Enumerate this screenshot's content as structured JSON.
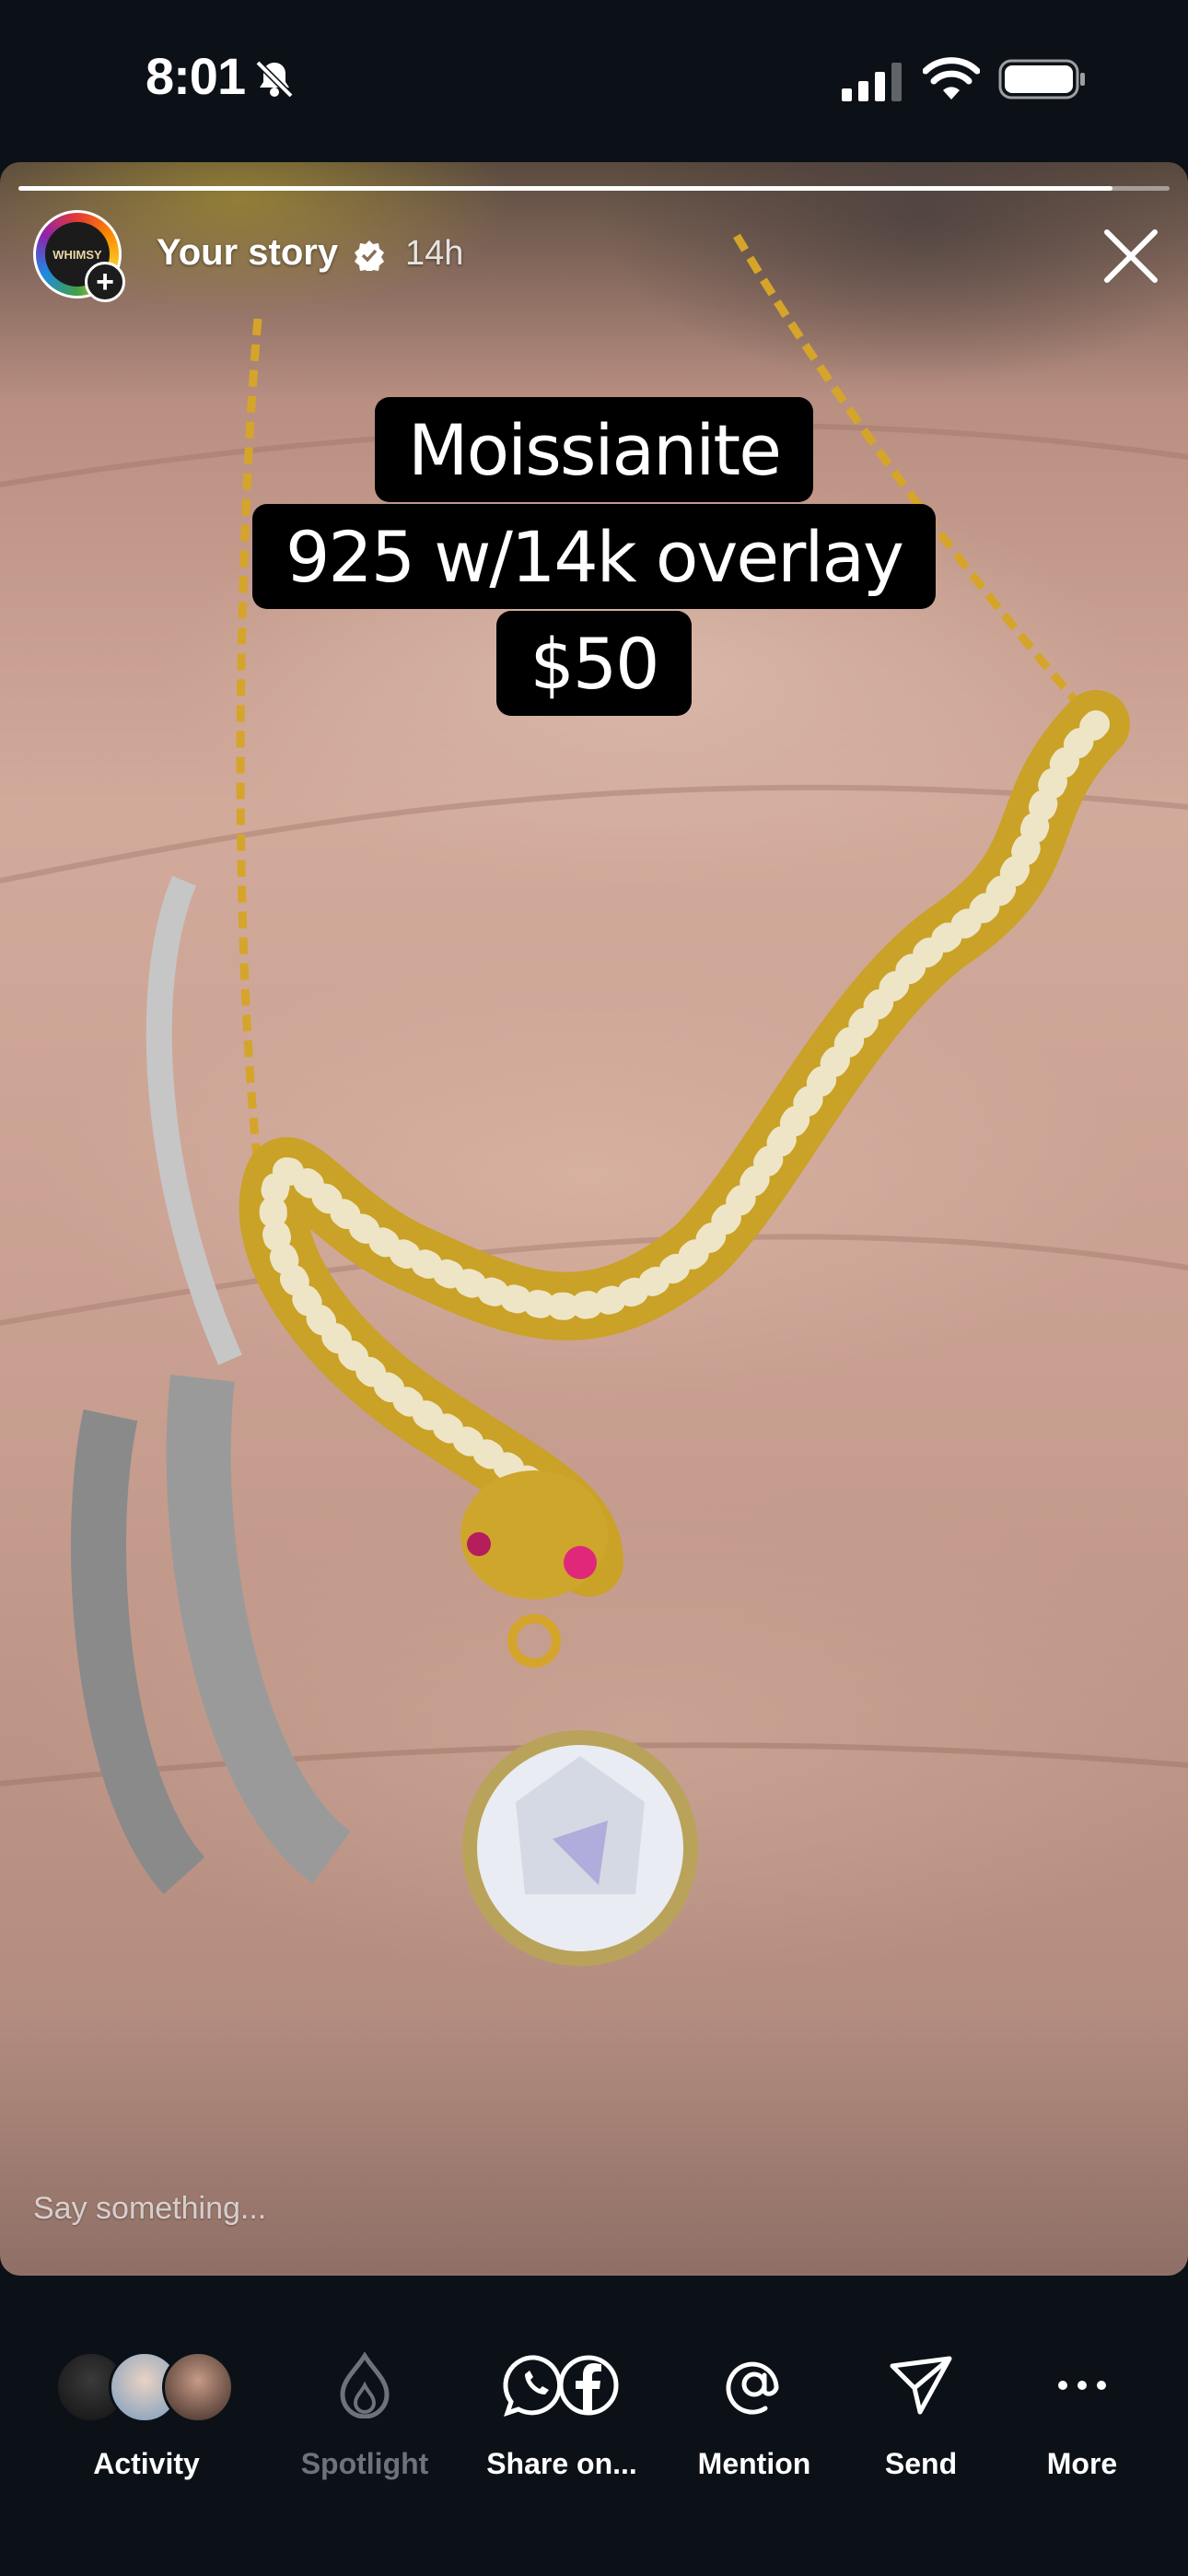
{
  "status_bar": {
    "time": "8:01",
    "icons": [
      "bell-slash-icon",
      "signal-bars-icon",
      "wifi-icon",
      "battery-full-icon"
    ]
  },
  "story": {
    "title": "Your story",
    "age": "14h",
    "verified": true,
    "progress": 0.95,
    "caption_lines": [
      "Moissianite",
      "925 w/14k overlay",
      "$50"
    ],
    "reply_placeholder": "Say something...",
    "avatar_text": "WHIMSY"
  },
  "bottom_actions": [
    {
      "label": "Activity",
      "icon": "activity-avatars-icon",
      "enabled": true
    },
    {
      "label": "Spotlight",
      "icon": "spotlight-flame-icon",
      "enabled": false
    },
    {
      "label": "Share on...",
      "icon": "whatsapp-facebook-icon",
      "enabled": true
    },
    {
      "label": "Mention",
      "icon": "at-sign-icon",
      "enabled": true
    },
    {
      "label": "Send",
      "icon": "paper-plane-icon",
      "enabled": true
    },
    {
      "label": "More",
      "icon": "ellipsis-icon",
      "enabled": true
    }
  ],
  "colors": {
    "background": "#0b1117",
    "dim_label": "#6c737b",
    "caption_bg": "#000000",
    "gold": "#d4a52a"
  }
}
